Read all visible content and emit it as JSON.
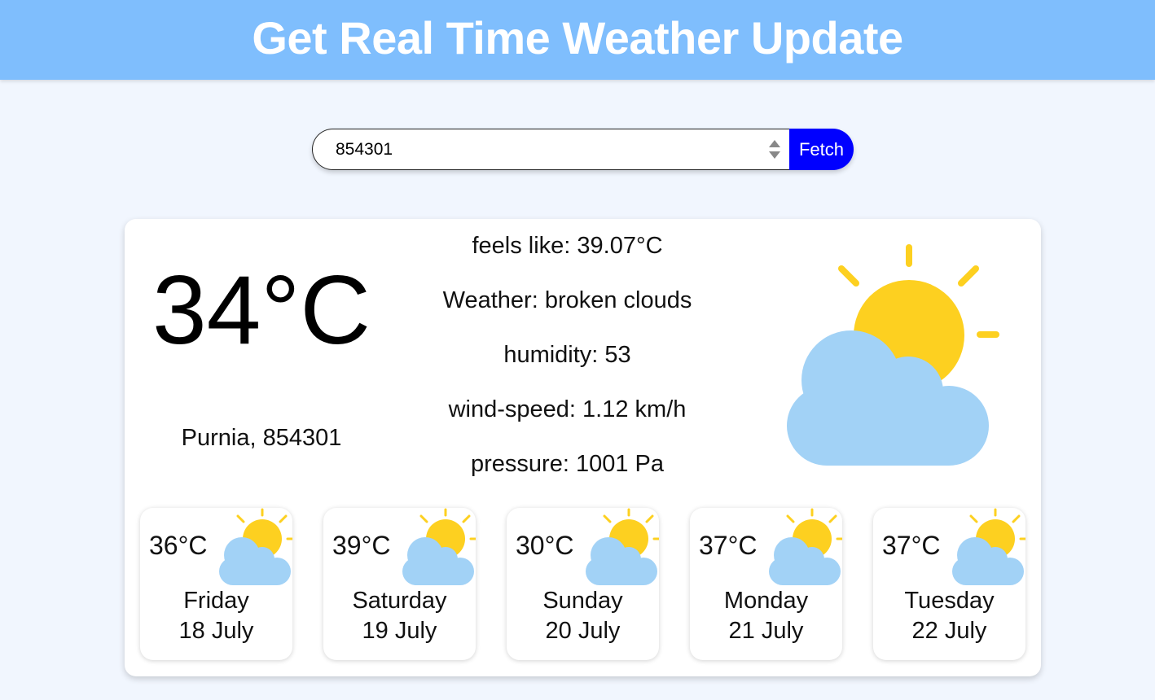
{
  "header": {
    "title": "Get Real Time Weather Update"
  },
  "search": {
    "value": "854301",
    "button_label": "Fetch"
  },
  "current": {
    "temperature": "34°C",
    "location": "Purnia, 854301",
    "details": [
      "feels like: 39.07°C",
      "Weather: broken clouds",
      "humidity: 53",
      "wind-speed: 1.12 km/h",
      "pressure: 1001 Pa"
    ],
    "icon": "partly-cloudy-icon"
  },
  "forecast": [
    {
      "temp": "36°C",
      "day": "Friday",
      "date": "18 July",
      "icon": "partly-cloudy-icon"
    },
    {
      "temp": "39°C",
      "day": "Saturday",
      "date": "19 July",
      "icon": "partly-cloudy-icon"
    },
    {
      "temp": "30°C",
      "day": "Sunday",
      "date": "20 July",
      "icon": "partly-cloudy-icon"
    },
    {
      "temp": "37°C",
      "day": "Monday",
      "date": "21 July",
      "icon": "partly-cloudy-icon"
    },
    {
      "temp": "37°C",
      "day": "Tuesday",
      "date": "22 July",
      "icon": "partly-cloudy-icon"
    }
  ],
  "colors": {
    "header_bg": "#7fbefd",
    "page_bg": "#f1f6fe",
    "button_bg": "#0000ff",
    "sun": "#fdd020",
    "cloud": "#a2d2f6"
  }
}
